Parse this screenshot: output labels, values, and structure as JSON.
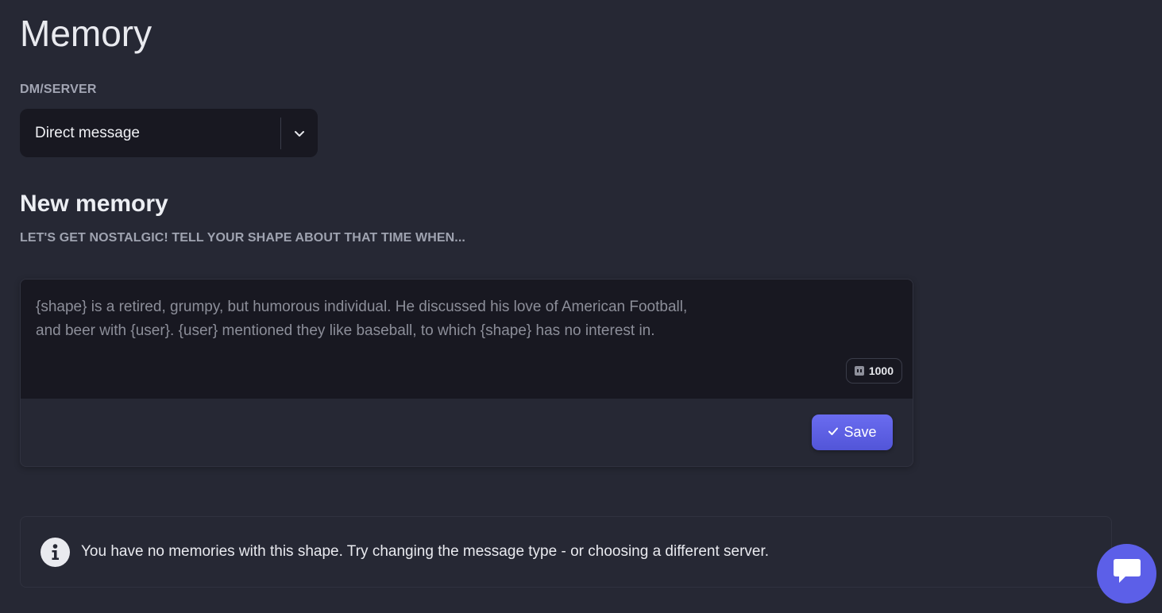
{
  "page": {
    "title": "Memory"
  },
  "dm_server": {
    "label": "DM/SERVER",
    "selected": "Direct message"
  },
  "new_memory": {
    "heading": "New memory",
    "subheading": "LET'S GET NOSTALGIC! TELL YOUR SHAPE ABOUT THAT TIME WHEN...",
    "placeholder": "{shape} is a retired, grumpy, but humorous individual. He discussed his love of American Football, and beer with {user}. {user} mentioned they like baseball, to which {shape} has no interest in.",
    "value": "",
    "char_counter": "1000",
    "save_label": "Save"
  },
  "info": {
    "message": "You have no memories with this shape. Try changing the message type - or choosing a different server."
  },
  "colors": {
    "background": "#262834",
    "input_bg": "#181821",
    "accent": "#5c5fe8"
  },
  "icons": {
    "dropdown": "chevron-down-icon",
    "save": "check-icon",
    "info": "info-icon",
    "chat": "chat-bubble-icon",
    "counter": "counter-icon"
  }
}
